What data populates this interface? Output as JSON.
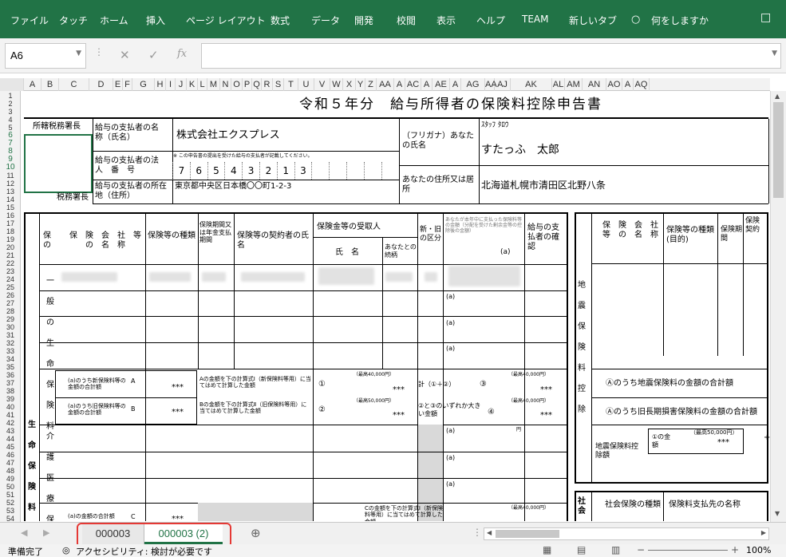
{
  "menu": [
    "ファイル",
    "タッチ",
    "ホーム",
    "挿入",
    "ページ レイアウト",
    "数式",
    "データ",
    "開発",
    "校閲",
    "表示",
    "ヘルプ",
    "TEAM",
    "新しいタブ",
    "何をしますか"
  ],
  "namebox": "A6",
  "columns": [
    "A",
    "B",
    "C",
    "D",
    "E",
    "F",
    "G",
    "H",
    "I",
    "J",
    "K",
    "L",
    "M",
    "N",
    "O",
    "P",
    "Q",
    "R",
    "S",
    "T",
    "U",
    "V",
    "W",
    "X",
    "Y",
    "Z",
    "AA",
    "A",
    "AC",
    "A",
    "AE",
    "A",
    "AG",
    "AA",
    "AJ",
    "AK",
    "AL",
    "AM",
    "AN",
    "AO",
    "A",
    "AQ"
  ],
  "rows": [
    "1",
    "2",
    "3",
    "4",
    "5",
    "6",
    "7",
    "8",
    "9",
    "10",
    "11",
    "12",
    "13",
    "14",
    "15",
    "16",
    "17",
    "18",
    "19",
    "20",
    "21",
    "22",
    "23",
    "24",
    "25",
    "26",
    "27",
    "28",
    "29",
    "30",
    "31",
    "32",
    "33",
    "34",
    "35",
    "36",
    "37",
    "38",
    "39",
    "40",
    "41",
    "42",
    "43",
    "44",
    "45",
    "46",
    "47",
    "48",
    "49",
    "50",
    "51",
    "52",
    "53",
    "54"
  ],
  "form": {
    "title": "令和５年分　給与所得者の保険料控除申告書",
    "tax_office_head": "所轄税務署長",
    "tax_office_label": "税務署長",
    "payer_name_label": "給与の支払者の名　称（氏名）",
    "payer_name": "株式会社エクスプレス",
    "payer_no_label": "給与の支払者の法　人　番　号",
    "payer_no_note": "※ この申告書の提出を受けた給与の支払者が記載してください。",
    "payer_no_digits": [
      "7",
      "6",
      "5",
      "4",
      "3",
      "2",
      "1",
      "3",
      "",
      "",
      "",
      "",
      ""
    ],
    "payer_addr_label": "給与の支払者の所在地（住所）",
    "payer_addr": "東京都中央区日本橋〇〇町1-2-3",
    "kana_label": "（フリガナ）あなたの氏名",
    "kana": "ｽﾀｯﾌ ﾀﾛｳ",
    "name": "すたっふ　太郎",
    "addr_label": "あなたの住所又は居所",
    "addr": "北海道札幌市清田区北野八条",
    "h_company": "保　険　会　社　等　の　名　称",
    "h_type": "保険等の種類",
    "h_period": "保険期間又は年金支払期間",
    "h_contractor": "保険等の契約者の氏名",
    "h_recipient": "保険金等の受取人",
    "h_rname": "氏　名",
    "h_rel": "あなたとの続柄",
    "h_newold": "新・旧の区分",
    "h_amount": "あなたが本年中に支払った保険料等の金額（分配を受けた剰余金等の控除後の金額）",
    "h_a": "(a)",
    "h_confirm": "給与の支払者の確認",
    "mark_a": "(a)",
    "side_life": "一般の生命保険料",
    "side_life2": "介護医療保険料",
    "side_main": "生命保険料",
    "lbl_new_total": "(a)のうち新保険料等の金額の合計額",
    "lbl_old_total": "(a)のうち旧保険料等の金額の合計額",
    "lbl_med_total": "(a)の金額の合計額",
    "A": "A",
    "B": "B",
    "C": "C",
    "stars": "***",
    "yen": "円",
    "calc_A": "Aの金額を下の計算式Ⅰ（新保険料等用）に当てはめて計算した金額",
    "calc_B": "Bの金額を下の計算式Ⅱ（旧保険料等用）に当てはめて計算した金額",
    "calc_C": "Cの金額を下の計算式Ⅰ（新保険料等用）に当てはめて計算した金額",
    "max40": "（最高40,000円）",
    "max50": "（最高50,000円）",
    "c1": "①",
    "c2": "②",
    "c3": "③",
    "c4": "④",
    "sum12": "計（①＋②）",
    "bigger": "②と③のいずれか大きい金額",
    "eq_label": "地震保険料",
    "eq_side": "地震保険料控除",
    "eq_new": "Ⓐのうち地震保険料の金額の合計額",
    "eq_old": "Ⓐのうち旧長期損害保険料の金額の合計額",
    "eq_deduct": "地震保険料控除額",
    "eq_max": "（最高50,000円）",
    "eq_amt": "①の金額",
    "r_company": "保　険　会　社　等　の　名　称",
    "r_type": "保険等の種類(目的)",
    "r_period": "保険期間",
    "r_contract": "保険契約",
    "social": "社会",
    "social_type": "社会保険の種類",
    "social_payee": "保険料支払先の名称"
  },
  "tabs": [
    "000003",
    "000003 (2)"
  ],
  "status": {
    "ready": "準備完了",
    "access": "アクセシビリティ: 検討が必要です",
    "zoom": "100%"
  },
  "colors": {
    "ribbon": "#217346",
    "tab_active": "#217346",
    "highlight": "#e53935"
  }
}
